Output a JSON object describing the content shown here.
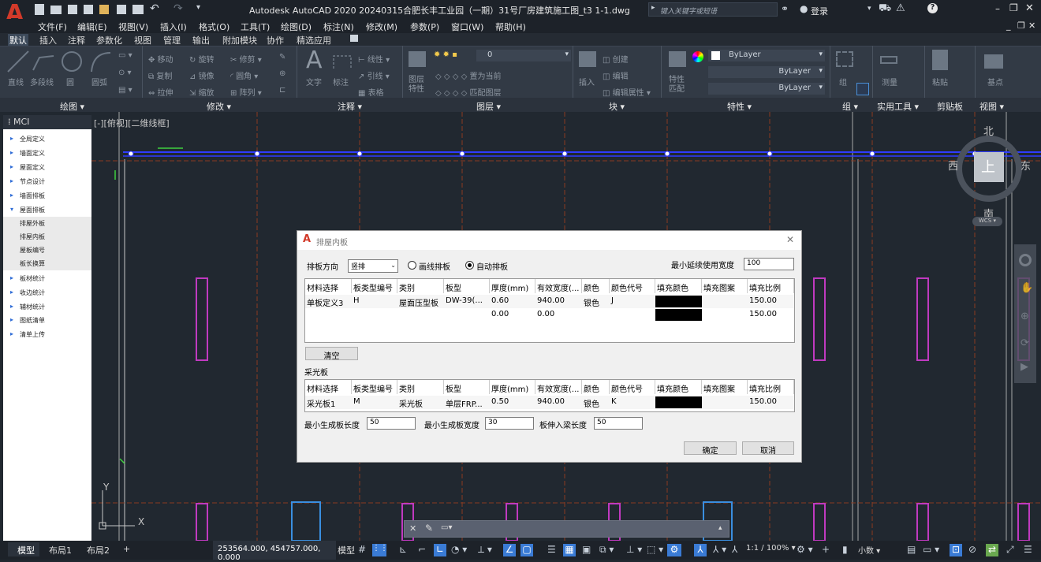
{
  "app": {
    "title": "Autodesk AutoCAD 2020   20240315合肥长丰工业园（一期）31号厂房建筑施工图_t3 1-1.dwg",
    "search_placeholder": "键入关键字或短语",
    "login": "登录",
    "logo": "A"
  },
  "menu": [
    "文件(F)",
    "编辑(E)",
    "视图(V)",
    "插入(I)",
    "格式(O)",
    "工具(T)",
    "绘图(D)",
    "标注(N)",
    "修改(M)",
    "参数(P)",
    "窗口(W)",
    "帮助(H)"
  ],
  "ribbon_tabs": [
    "默认",
    "插入",
    "注释",
    "参数化",
    "视图",
    "管理",
    "输出",
    "附加模块",
    "协作",
    "精选应用"
  ],
  "ribbon_panels": {
    "draw": {
      "title": "绘图",
      "tools": [
        "直线",
        "多段线",
        "圆",
        "圆弧"
      ]
    },
    "modify": {
      "title": "修改",
      "tools": [
        "移动",
        "旋转",
        "修剪",
        "复制",
        "镜像",
        "圆角",
        "拉伸",
        "缩放",
        "阵列"
      ]
    },
    "annotation": {
      "title": "注释",
      "tools": [
        "文字",
        "标注",
        "线性",
        "引线",
        "表格"
      ]
    },
    "layers": {
      "title": "图层",
      "tools": [
        "图层特性",
        "置为当前",
        "匹配图层"
      ],
      "current": "0"
    },
    "block": {
      "title": "块",
      "tools": [
        "插入",
        "创建",
        "编辑",
        "编辑属性"
      ]
    },
    "properties": {
      "title": "特性",
      "tools": [
        "特性匹配"
      ],
      "bylayer": [
        "ByLayer",
        "ByLayer",
        "ByLayer"
      ]
    },
    "groups": {
      "title": "组",
      "tools": [
        "组"
      ]
    },
    "utilities": {
      "title": "实用工具",
      "tools": [
        "测量"
      ]
    },
    "clipboard": {
      "title": "剪贴板",
      "tools": [
        "粘贴"
      ]
    },
    "view": {
      "title": "视图",
      "tools": [
        "基点"
      ]
    }
  },
  "palette": {
    "title": "MCI",
    "items": [
      {
        "label": "全局定义",
        "sub": false,
        "expanded": false
      },
      {
        "label": "墙面定义",
        "sub": false,
        "expanded": false
      },
      {
        "label": "屋面定义",
        "sub": false,
        "expanded": false
      },
      {
        "label": "节点设计",
        "sub": false,
        "expanded": false
      },
      {
        "label": "墙面排板",
        "sub": false,
        "expanded": false
      },
      {
        "label": "屋面排板",
        "sub": false,
        "expanded": true
      },
      {
        "label": "排屋外板",
        "sub": true
      },
      {
        "label": "排屋内板",
        "sub": true
      },
      {
        "label": "屋板编号",
        "sub": true
      },
      {
        "label": "板长换算",
        "sub": true
      },
      {
        "label": "板材统计",
        "sub": false,
        "expanded": false
      },
      {
        "label": "收边统计",
        "sub": false,
        "expanded": false
      },
      {
        "label": "辅材统计",
        "sub": false,
        "expanded": false
      },
      {
        "label": "图纸清单",
        "sub": false,
        "expanded": false
      },
      {
        "label": "清单上传",
        "sub": false,
        "expanded": false
      }
    ]
  },
  "viewport": {
    "label": "[-][俯视][二维线框]",
    "viewcube": {
      "north": "北",
      "south": "南",
      "east": "东",
      "west": "西",
      "top": "上",
      "wcs": "WCS"
    },
    "ucs": {
      "x": "X",
      "y": "Y"
    }
  },
  "dialog": {
    "title": "排屋内板",
    "direction_label": "排板方向",
    "direction_value": "竖排",
    "radio_line": "画线排板",
    "radio_auto": "自动排板",
    "radio_selected": "auto",
    "min_extend_label": "最小延续使用宽度",
    "min_extend_value": "100",
    "columns": [
      "材料选择",
      "板类型编号",
      "类别",
      "板型",
      "厚度(mm)",
      "有效宽度(...",
      "颜色",
      "颜色代号",
      "填充颜色",
      "填充图案",
      "填充比例"
    ],
    "rows": [
      [
        "单板定义3",
        "H",
        "屋面压型板",
        "DW-39(...",
        "0.60",
        "940.00",
        "银色",
        "J",
        "",
        "",
        "150.00"
      ],
      [
        "",
        "",
        "",
        "",
        "0.00",
        "0.00",
        "",
        "",
        "",
        "",
        "150.00"
      ]
    ],
    "clear_button": "清空",
    "skylight_label": "采光板",
    "skylight_rows": [
      [
        "采光板1",
        "M",
        "采光板",
        "单层FRP...",
        "0.50",
        "940.00",
        "银色",
        "K",
        "",
        "",
        "150.00"
      ]
    ],
    "min_length_label": "最小生成板长度",
    "min_length_value": "50",
    "min_width_label": "最小生成板宽度",
    "min_width_value": "30",
    "beam_label": "板伸入梁长度",
    "beam_value": "50",
    "ok": "确定",
    "cancel": "取消",
    "fill_color": "#000000"
  },
  "statusbar": {
    "tabs": [
      "模型",
      "布局1",
      "布局2"
    ],
    "coords": "253564.000, 454757.000, 0.000",
    "model": "模型",
    "scale": "1:1 / 100%",
    "units": "小数"
  },
  "colors": {
    "accent": "#c0392b",
    "magenta_column": "#c03ac0",
    "blue_axis": "#2f3cff",
    "dialog_bg": "#f0f0f0"
  }
}
